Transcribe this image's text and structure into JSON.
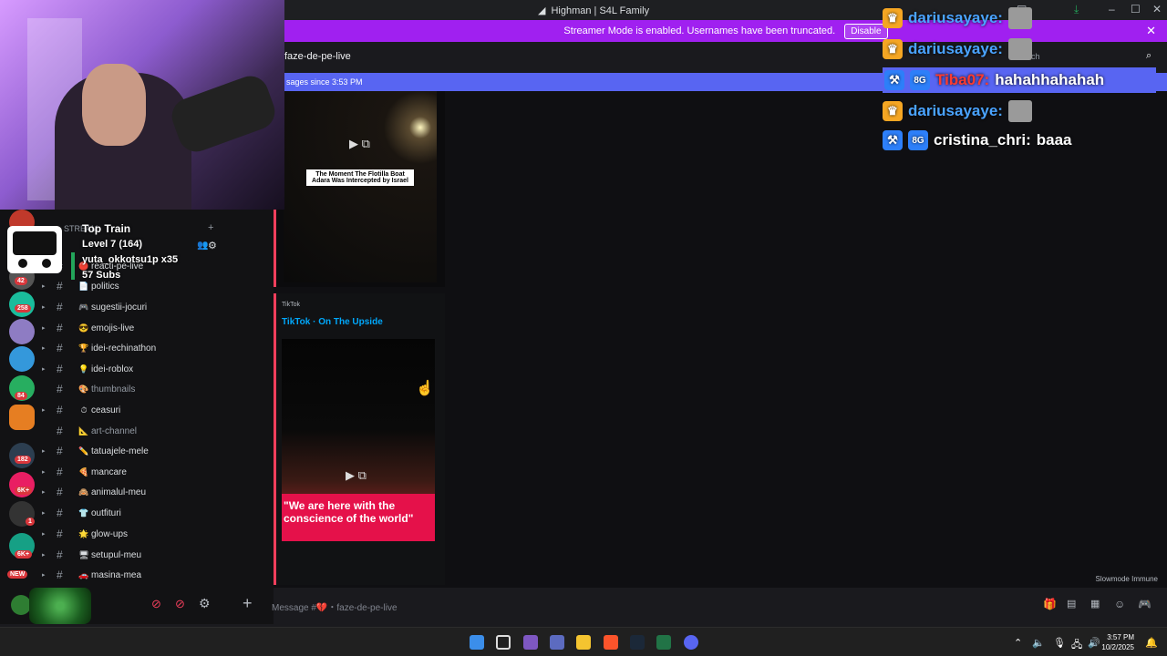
{
  "window": {
    "title": "Highman | S4L Family"
  },
  "banner": {
    "text": "Streamer Mode is enabled. Usernames have been truncated.",
    "button": "Disable"
  },
  "channel_header": {
    "name": "faze-de-pe-live",
    "search_placeholder": "Search"
  },
  "new_messages": {
    "text": "sages since 3:53 PM"
  },
  "train": {
    "title": "Top Train",
    "level": "Level 7 (164)",
    "user": "yuta_okkotsu1p x35",
    "subs": "57 Subs"
  },
  "sidebar": {
    "header": "STREAM",
    "items": [
      {
        "emoji": "🔴",
        "label": "reacti-pe-live"
      },
      {
        "emoji": "📄",
        "label": "politics"
      },
      {
        "emoji": "🎮",
        "label": "sugestii-jocuri"
      },
      {
        "emoji": "😎",
        "label": "emojis-live"
      },
      {
        "emoji": "🏆",
        "label": "idei-rechinathon"
      },
      {
        "emoji": "💡",
        "label": "idei-roblox"
      },
      {
        "emoji": "🎨",
        "label": "thumbnails",
        "dim": true
      },
      {
        "emoji": "⏱",
        "label": "ceasuri"
      },
      {
        "emoji": "📐",
        "label": "art-channel",
        "dim": true
      },
      {
        "emoji": "✏️",
        "label": "tatuajele-mele"
      },
      {
        "emoji": "🍕",
        "label": "mancare"
      },
      {
        "emoji": "🙈",
        "label": "animalul-meu"
      },
      {
        "emoji": "👕",
        "label": "outfituri"
      },
      {
        "emoji": "🌟",
        "label": "glow-ups"
      },
      {
        "emoji": "🖥",
        "label": "setupul-meu"
      },
      {
        "emoji": "🚗",
        "label": "masina-mea"
      }
    ]
  },
  "guild_badges": [
    "42",
    "258",
    "84",
    "182",
    "6K+",
    "1",
    "6K+",
    "NEW"
  ],
  "messages": [
    {
      "embed_text": "The Moment The Flotilla Boat Adara Was Intercepted by Israel"
    },
    {
      "provider": "TikTok",
      "title": "TikTok · On The Upside",
      "caption": "\"We are here with the conscience of the world\""
    }
  ],
  "composer": {
    "placeholder": "Message #💔・faze-de-pe-live"
  },
  "slowmode": "Slowmode Immune",
  "twitch_chat": [
    {
      "user": "dariusayaye:",
      "message": "",
      "color": "#4aa3ff",
      "highlight": false
    },
    {
      "user": "dariusayaye:",
      "message": "",
      "color": "#4aa3ff",
      "highlight": false
    },
    {
      "user": "Tiba07:",
      "message": "hahahhahahah",
      "color": "#ff3b30",
      "highlight": true
    },
    {
      "user": "dariusayaye:",
      "message": "",
      "color": "#4aa3ff",
      "highlight": false
    },
    {
      "user": "cristina_chri:",
      "message": "baaa",
      "color": "#ffffff",
      "highlight": false
    }
  ],
  "clock": {
    "time": "3:57 PM",
    "date": "10/2/2025"
  },
  "colors": {
    "accent": "#5865f2",
    "banner": "#a020f0",
    "highlight": "#5865f2",
    "pink": "#f23f5c"
  }
}
